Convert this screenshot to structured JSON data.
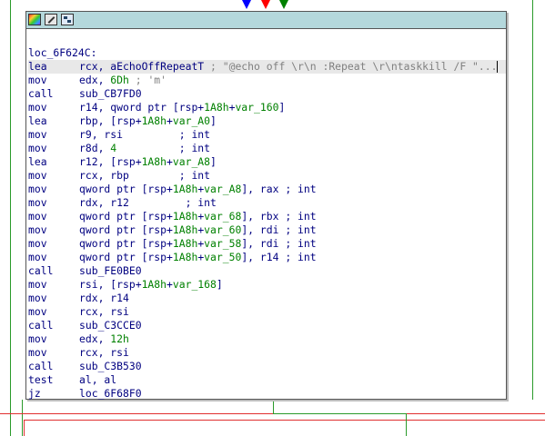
{
  "colors": {
    "background": "#ffffff",
    "title_bar": "#b4d8dc",
    "keyword_blue": "#000080",
    "literal_green": "#008000",
    "comment_gray": "#808080",
    "arrow_blue": "#0000ff",
    "arrow_red": "#ff0000",
    "arrow_green": "#008000"
  },
  "toolbar": {
    "icons": [
      "color-palette-icon",
      "edit-node-icon",
      "graph-node-icon"
    ]
  },
  "code": {
    "label": "loc_6F624C:",
    "lines": [
      {
        "mnemonic": "lea",
        "ops": [
          [
            "op",
            "rcx, aEchoOffRepeatT "
          ],
          [
            "cmt",
            "; \"@echo off \\r\\n :Repeat \\r\\ntaskkill /F \"..."
          ]
        ]
      },
      {
        "mnemonic": "mov",
        "ops": [
          [
            "op",
            "edx, "
          ],
          [
            "num",
            "6Dh"
          ],
          [
            "cmt",
            " ; 'm'"
          ]
        ]
      },
      {
        "mnemonic": "call",
        "ops": [
          [
            "op",
            "sub_CB7FD0"
          ]
        ]
      },
      {
        "mnemonic": "mov",
        "ops": [
          [
            "op",
            "r14, qword ptr [rsp+"
          ],
          [
            "var",
            "1A8h"
          ],
          [
            "op",
            "+"
          ],
          [
            "var",
            "var_160"
          ],
          [
            "op",
            "]"
          ]
        ]
      },
      {
        "mnemonic": "lea",
        "ops": [
          [
            "op",
            "rbp, [rsp+"
          ],
          [
            "var",
            "1A8h"
          ],
          [
            "op",
            "+"
          ],
          [
            "var",
            "var_A0"
          ],
          [
            "op",
            "]"
          ]
        ]
      },
      {
        "mnemonic": "mov",
        "ops": [
          [
            "op",
            "r9, rsi         "
          ],
          [
            "op",
            "; int"
          ]
        ]
      },
      {
        "mnemonic": "mov",
        "ops": [
          [
            "op",
            "r8d, "
          ],
          [
            "num",
            "4"
          ],
          [
            "op",
            "          ; int"
          ]
        ]
      },
      {
        "mnemonic": "lea",
        "ops": [
          [
            "op",
            "r12, [rsp+"
          ],
          [
            "var",
            "1A8h"
          ],
          [
            "op",
            "+"
          ],
          [
            "var",
            "var_A8"
          ],
          [
            "op",
            "]"
          ]
        ]
      },
      {
        "mnemonic": "mov",
        "ops": [
          [
            "op",
            "rcx, rbp        ; int"
          ]
        ]
      },
      {
        "mnemonic": "mov",
        "ops": [
          [
            "op",
            "qword ptr [rsp+"
          ],
          [
            "var",
            "1A8h"
          ],
          [
            "op",
            "+"
          ],
          [
            "var",
            "var_A8"
          ],
          [
            "op",
            "], rax ; int"
          ]
        ]
      },
      {
        "mnemonic": "mov",
        "ops": [
          [
            "op",
            "rdx, r12         ; int"
          ]
        ]
      },
      {
        "mnemonic": "mov",
        "ops": [
          [
            "op",
            "qword ptr [rsp+"
          ],
          [
            "var",
            "1A8h"
          ],
          [
            "op",
            "+"
          ],
          [
            "var",
            "var_68"
          ],
          [
            "op",
            "], rbx ; int"
          ]
        ]
      },
      {
        "mnemonic": "mov",
        "ops": [
          [
            "op",
            "qword ptr [rsp+"
          ],
          [
            "var",
            "1A8h"
          ],
          [
            "op",
            "+"
          ],
          [
            "var",
            "var_60"
          ],
          [
            "op",
            "], rdi ; int"
          ]
        ]
      },
      {
        "mnemonic": "mov",
        "ops": [
          [
            "op",
            "qword ptr [rsp+"
          ],
          [
            "var",
            "1A8h"
          ],
          [
            "op",
            "+"
          ],
          [
            "var",
            "var_58"
          ],
          [
            "op",
            "], rdi ; int"
          ]
        ]
      },
      {
        "mnemonic": "mov",
        "ops": [
          [
            "op",
            "qword ptr [rsp+"
          ],
          [
            "var",
            "1A8h"
          ],
          [
            "op",
            "+"
          ],
          [
            "var",
            "var_50"
          ],
          [
            "op",
            "], r14 ; int"
          ]
        ]
      },
      {
        "mnemonic": "call",
        "ops": [
          [
            "op",
            "sub_FE0BE0"
          ]
        ]
      },
      {
        "mnemonic": "mov",
        "ops": [
          [
            "op",
            "rsi, [rsp+"
          ],
          [
            "var",
            "1A8h"
          ],
          [
            "op",
            "+"
          ],
          [
            "var",
            "var_168"
          ],
          [
            "op",
            "]"
          ]
        ]
      },
      {
        "mnemonic": "mov",
        "ops": [
          [
            "op",
            "rdx, r14"
          ]
        ]
      },
      {
        "mnemonic": "mov",
        "ops": [
          [
            "op",
            "rcx, rsi"
          ]
        ]
      },
      {
        "mnemonic": "call",
        "ops": [
          [
            "op",
            "sub_C3CCE0"
          ]
        ]
      },
      {
        "mnemonic": "mov",
        "ops": [
          [
            "op",
            "edx, "
          ],
          [
            "num",
            "12h"
          ]
        ]
      },
      {
        "mnemonic": "mov",
        "ops": [
          [
            "op",
            "rcx, rsi"
          ]
        ]
      },
      {
        "mnemonic": "call",
        "ops": [
          [
            "op",
            "sub_C3B530"
          ]
        ]
      },
      {
        "mnemonic": "test",
        "ops": [
          [
            "op",
            "al, al"
          ]
        ]
      },
      {
        "mnemonic": "jz",
        "ops": [
          [
            "op",
            "loc_6F68F0"
          ]
        ]
      }
    ]
  }
}
